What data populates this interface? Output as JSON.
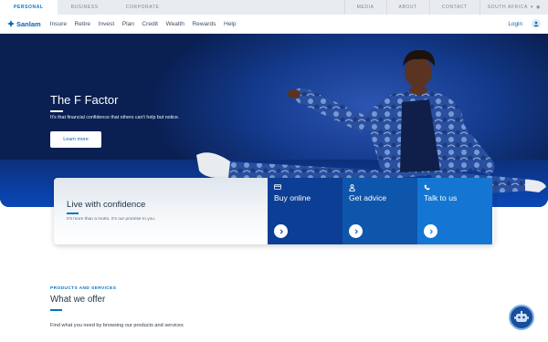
{
  "topbar": {
    "segments": [
      "PERSONAL",
      "BUSINESS",
      "CORPORATE"
    ],
    "links": [
      "MEDIA",
      "ABOUT",
      "CONTACT"
    ],
    "region": "SOUTH AFRICA"
  },
  "navbar": {
    "logo": "Sanlam",
    "items": [
      "Insure",
      "Retire",
      "Invest",
      "Plan",
      "Credit",
      "Wealth",
      "Rewards",
      "Help"
    ],
    "login": "Login"
  },
  "hero": {
    "title": "The F Factor",
    "subtitle": "It's that financial confidence that others can't help but notice.",
    "cta": "Learn more"
  },
  "cards": {
    "main_title": "Live with confidence",
    "main_sub": "It's more than a motto. It's our promise to you.",
    "items": [
      {
        "label": "Buy online",
        "icon": "card-icon"
      },
      {
        "label": "Get advice",
        "icon": "person-icon"
      },
      {
        "label": "Talk to us",
        "icon": "phone-icon"
      }
    ]
  },
  "section": {
    "eyebrow": "PRODUCTS AND SERVICES",
    "title": "What we offer",
    "desc": "Find what you need by browsing our products and services"
  },
  "colors": {
    "brand": "#0075c9",
    "navy": "#0b3e94",
    "blue": "#0d56ab",
    "light_blue": "#1476d2"
  }
}
